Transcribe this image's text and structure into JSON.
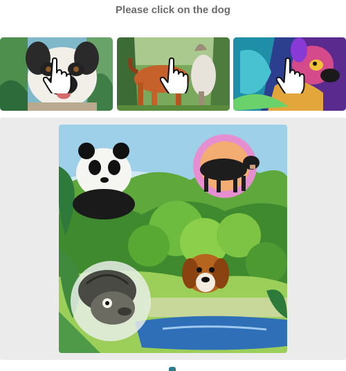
{
  "prompt": {
    "text": "Please click on the dog"
  },
  "choices": [
    {
      "subject": "dog",
      "icon": "pointer-hand-icon"
    },
    {
      "subject": "horse",
      "icon": "pointer-hand-icon"
    },
    {
      "subject": "dog-colorful",
      "icon": "pointer-hand-icon"
    }
  ],
  "scene": {
    "subjects": [
      "panda",
      "cow",
      "dog",
      "tortoise"
    ],
    "style": "watercolor jungle with river"
  },
  "footer": {
    "left_text": ""
  },
  "colors": {
    "prompt_text": "#6b6b6b",
    "panel_bg": "#ebebeb",
    "accent": "#2d7d8c"
  }
}
